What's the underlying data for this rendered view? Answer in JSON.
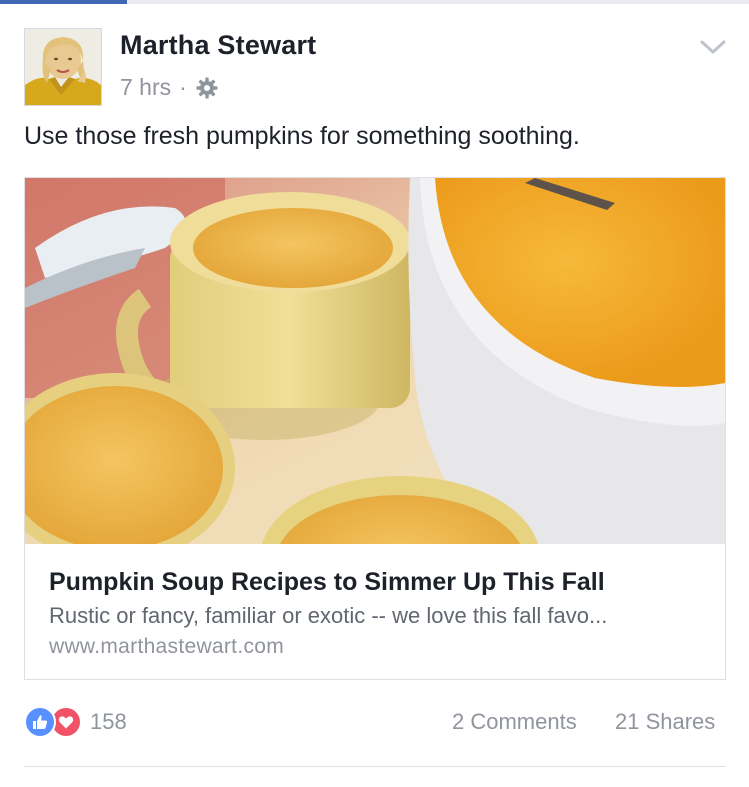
{
  "progress": {
    "fraction": 0.17,
    "color": "#4267b2"
  },
  "post": {
    "author": "Martha Stewart",
    "timestamp": "7 hrs",
    "separator": "·",
    "privacy_icon": "gear-icon",
    "menu_icon": "chevron-down-icon",
    "text": "Use those fresh pumpkins for something soothing."
  },
  "link": {
    "title": "Pumpkin Soup Recipes to Simmer Up This Fall",
    "description": "Rustic or fancy, familiar or exotic -- we love this fall favo...",
    "domain": "www.marthastewart.com",
    "image_icon": "pumpkin-soup-photo"
  },
  "engagement": {
    "reaction_icons": [
      "like-icon",
      "love-icon"
    ],
    "reaction_count": "158",
    "comments": "2 Comments",
    "shares": "21 Shares"
  },
  "colors": {
    "like": "#5890ff",
    "love": "#f25268",
    "muted_text": "#90949c"
  }
}
